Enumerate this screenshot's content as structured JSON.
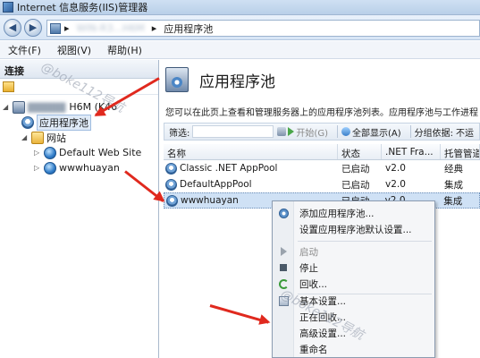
{
  "window": {
    "title": "Internet 信息服务(IIS)管理器"
  },
  "address": {
    "segment_server": "WIN-R3...H6M",
    "segment_pools": "应用程序池"
  },
  "menu": [
    "文件(F)",
    "视图(V)",
    "帮助(H)"
  ],
  "connections": {
    "title": "连接",
    "server_label": "WIN-R3...H6M (K46",
    "server_suffix": "H6M (K46",
    "items": {
      "app_pools": "应用程序池",
      "sites": "网站",
      "site1": "Default Web Site",
      "site2": "wwwhuayan"
    }
  },
  "main": {
    "title": "应用程序池",
    "description": "您可以在此页上查看和管理服务器上的应用程序池列表。应用程序池与工作进程"
  },
  "filter": {
    "label": "筛选:",
    "go": "开始(G)",
    "show_all": "全部显示(A)",
    "group_by": "分组依据:",
    "group_value": "不运"
  },
  "table": {
    "columns": [
      "名称",
      "状态",
      ".NET Fra...",
      "托管管道"
    ],
    "rows": [
      [
        "Classic .NET AppPool",
        "已启动",
        "v2.0",
        "经典"
      ],
      [
        "DefaultAppPool",
        "已启动",
        "v2.0",
        "集成"
      ],
      [
        "wwwhuayan",
        "已启动",
        "v2.0",
        "集成"
      ]
    ]
  },
  "context_menu": {
    "add": "添加应用程序池...",
    "defaults": "设置应用程序池默认设置...",
    "start": "启动",
    "stop": "停止",
    "recycle": "回收...",
    "basic": "基本设置...",
    "recycling": "正在回收...",
    "advanced": "高级设置...",
    "rename": "重命名"
  },
  "watermarks": [
    "@boke112导航",
    "@boke112导航"
  ],
  "colors": {
    "arrow": "#e0291e",
    "selection": "#cfe1f5"
  }
}
